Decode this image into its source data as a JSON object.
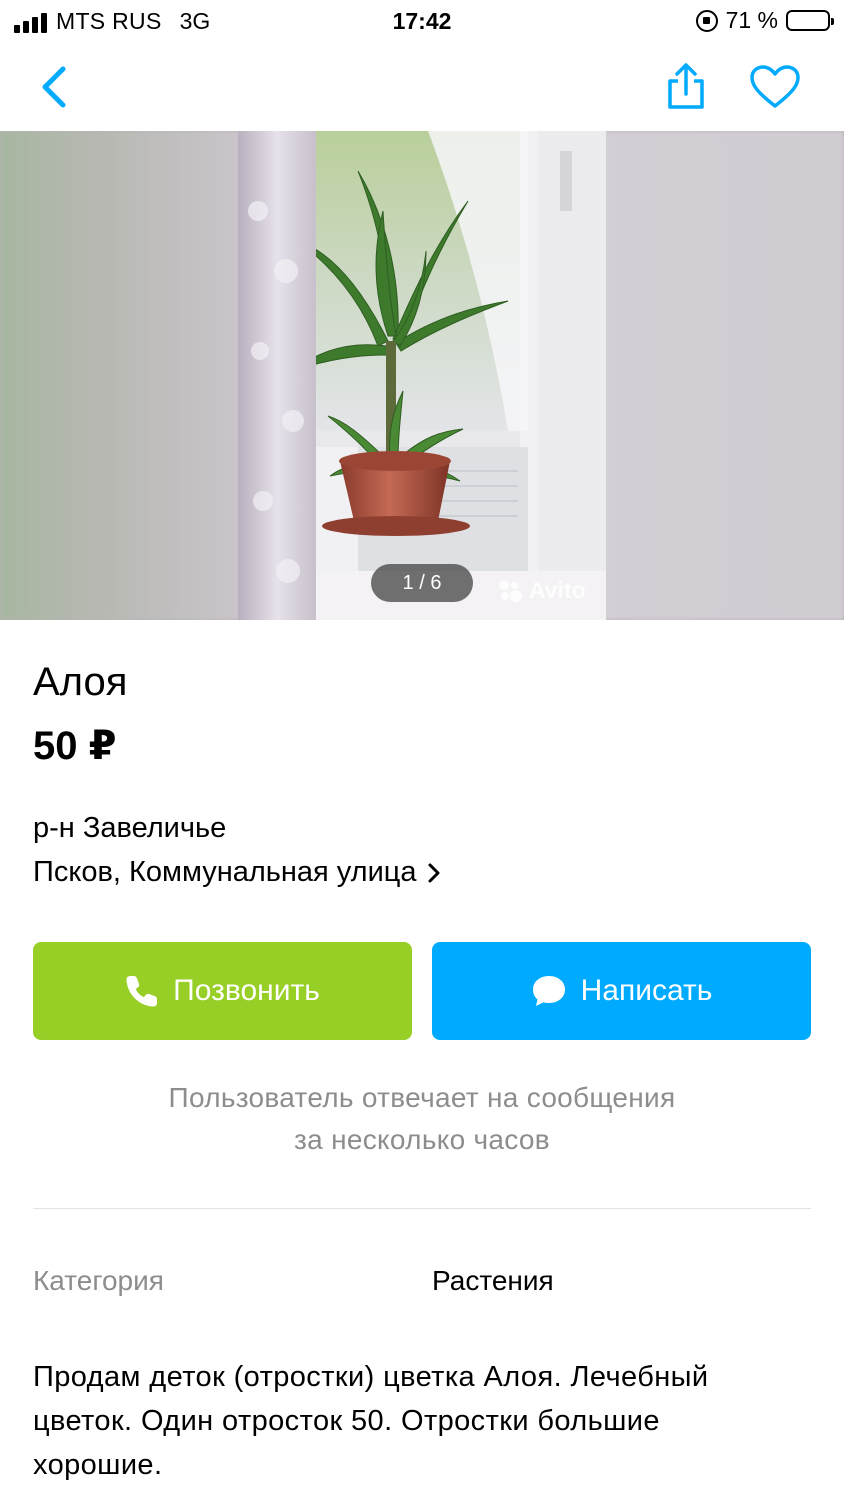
{
  "status_bar": {
    "carrier": "MTS RUS",
    "network": "3G",
    "time": "17:42",
    "battery": "71 %",
    "battery_level": 0.71
  },
  "nav": {
    "back_icon": "chevron-left-icon",
    "share_icon": "share-icon",
    "favorite_icon": "heart-icon"
  },
  "gallery": {
    "counter": "1 / 6",
    "watermark": "Avito"
  },
  "listing": {
    "title": "Алоя",
    "price": "50 ₽",
    "district": "р-н Завеличье",
    "address": "Псков, Коммунальная улица"
  },
  "actions": {
    "call_label": "Позвонить",
    "write_label": "Написать"
  },
  "reply_note": {
    "line1": "Пользователь отвечает на сообщения",
    "line2": "за несколько часов"
  },
  "params": {
    "category_label": "Категория",
    "category_value": "Растения"
  },
  "description": "Продам деток (отростки) цветка Алоя. Лечебный цветок. Один отросток 50. Отростки большие хорошие.",
  "colors": {
    "accent_blue": "#00aaff",
    "call_green": "#97cf26",
    "muted_text": "#8d8d8d"
  }
}
